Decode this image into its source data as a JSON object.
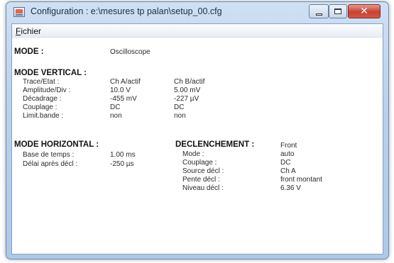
{
  "window": {
    "title": "Configuration : e:\\mesures tp palan\\setup_00.cfg"
  },
  "menu": {
    "items": [
      "Fichier"
    ]
  },
  "mode": {
    "label": "MODE :",
    "value": "Oscilloscope"
  },
  "vertical": {
    "heading": "MODE VERTICAL :",
    "rows": [
      {
        "label": "Trace/Etat :",
        "cha": "Ch A/actif",
        "chb": "Ch B/actif"
      },
      {
        "label": "Amplitude/Div :",
        "cha": "10.0 V",
        "chb": "5.00 mV"
      },
      {
        "label": "Décadrage :",
        "cha": "-455 mV",
        "chb": "-227 µV"
      },
      {
        "label": "Couplage :",
        "cha": "DC",
        "chb": "DC"
      },
      {
        "label": "Limit.bande :",
        "cha": "non",
        "chb": "non"
      }
    ]
  },
  "horizontal": {
    "heading": "MODE HORIZONTAL :",
    "rows": [
      {
        "label": "Base de temps :",
        "value": "1.00 ms"
      },
      {
        "label": "Délai après décl :",
        "value": "-250 µs"
      }
    ]
  },
  "trigger": {
    "heading": "DECLENCHEMENT :",
    "heading_value": "Front",
    "rows": [
      {
        "label": "Mode :",
        "value": "auto"
      },
      {
        "label": "Couplage :",
        "value": "DC"
      },
      {
        "label": "Source décl :",
        "value": "Ch A"
      },
      {
        "label": "Pente décl :",
        "value": "front montant"
      },
      {
        "label": "Niveau décl :",
        "value": "6.36 V"
      }
    ]
  },
  "colors": {
    "title_gradient_top": "#cfe0f3",
    "close_button": "#c8412f"
  },
  "icons": [
    "app-icon",
    "minimize-icon",
    "maximize-icon",
    "close-icon"
  ]
}
